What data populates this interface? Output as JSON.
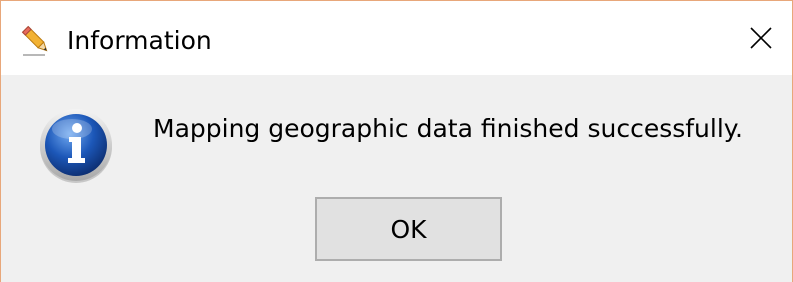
{
  "dialog": {
    "title": "Information",
    "message": "Mapping geographic data finished successfully.",
    "ok_label": "OK",
    "title_icon": "pencil-icon",
    "message_icon": "info-icon",
    "close_icon": "close-icon"
  },
  "colors": {
    "window_border": "#e8a77a",
    "titlebar_bg": "#ffffff",
    "content_bg": "#f0f0f0",
    "button_bg": "#e1e1e1",
    "button_border": "#adadad",
    "info_blue": "#1c57b8"
  }
}
